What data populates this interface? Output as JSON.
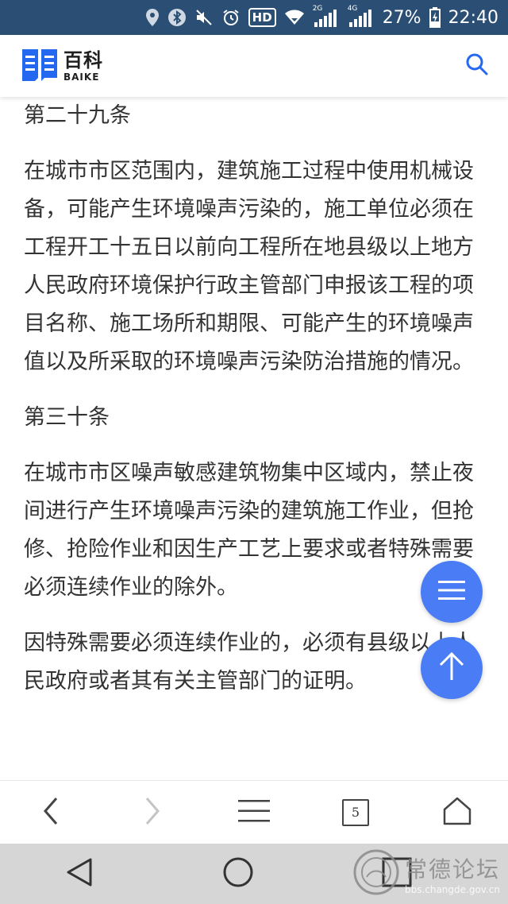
{
  "status_bar": {
    "battery_percent": "27%",
    "time": "22:40",
    "network_2g": "2G",
    "network_4g": "4G",
    "hd_badge": "HD",
    "icons": [
      "location-icon",
      "bluetooth-icon",
      "mute-icon",
      "alarm-icon",
      "hd-icon",
      "wifi-icon",
      "signal-icon",
      "battery-icon"
    ]
  },
  "header": {
    "logo_cn": "百科",
    "logo_en": "BAIKE",
    "brand_color": "#2468f2"
  },
  "article": {
    "sections": [
      {
        "heading": "第二十九条",
        "paragraphs": [
          "在城市市区范围内，建筑施工过程中使用机械设备，可能产生环境噪声污染的，施工单位必须在工程开工十五日以前向工程所在地县级以上地方人民政府环境保护行政主管部门申报该工程的项目名称、施工场所和期限、可能产生的环境噪声值以及所采取的环境噪声污染防治措施的情况。"
        ]
      },
      {
        "heading": "第三十条",
        "paragraphs": [
          "在城市市区噪声敏感建筑物集中区域内，禁止夜间进行产生环境噪声污染的建筑施工作业，但抢修、抢险作业和因生产工艺上要求或者特殊需要必须连续作业的除外。",
          "因特殊需要必须连续作业的，必须有县级以上人民政府或者其有关主管部门的证明。"
        ]
      }
    ]
  },
  "fab": {
    "color": "#4a7df5"
  },
  "toolbar": {
    "tab_count": "5"
  },
  "watermark": {
    "title": "常德论坛",
    "url": "bbs.changde.gov.cn"
  }
}
